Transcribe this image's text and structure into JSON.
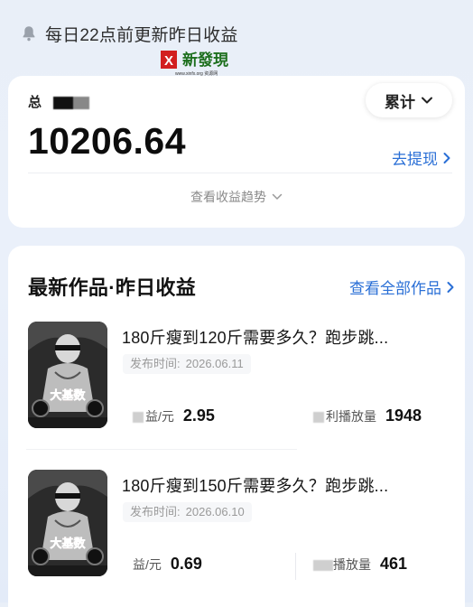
{
  "notice": {
    "text": "每日22点前更新昨日收益"
  },
  "watermark": {
    "text": "X 新發現",
    "subtext": "www.xinfx.org 资源网"
  },
  "earnings": {
    "total_label": "总",
    "amount": "10206.64",
    "range_label": "累计",
    "withdraw_label": "去提现",
    "trend_label": "查看收益趋势"
  },
  "works": {
    "title": "最新作品·昨日收益",
    "view_all_label": "查看全部作品",
    "publish_label": "发布时间:",
    "items": [
      {
        "title": "180斤瘦到120斤需要多久？跑步跳...",
        "date": "2026.06.11",
        "income_label": "益/元",
        "income_value": "2.95",
        "plays_label": "利播放量",
        "plays_value": "1948",
        "thumb_text": "大基数"
      },
      {
        "title": "180斤瘦到150斤需要多久？跑步跳...",
        "date": "2026.06.10",
        "income_label": "益/元",
        "income_value": "0.69",
        "plays_label": "播放量",
        "plays_value": "461",
        "thumb_text": "大基数"
      }
    ]
  },
  "colors": {
    "accent": "#2a6fd6",
    "background": "#e9eff8",
    "card": "#ffffff"
  },
  "icons": {
    "bell": "bell-icon",
    "chevron_down": "chevron-down-icon",
    "chevron_right": "chevron-right-icon"
  }
}
